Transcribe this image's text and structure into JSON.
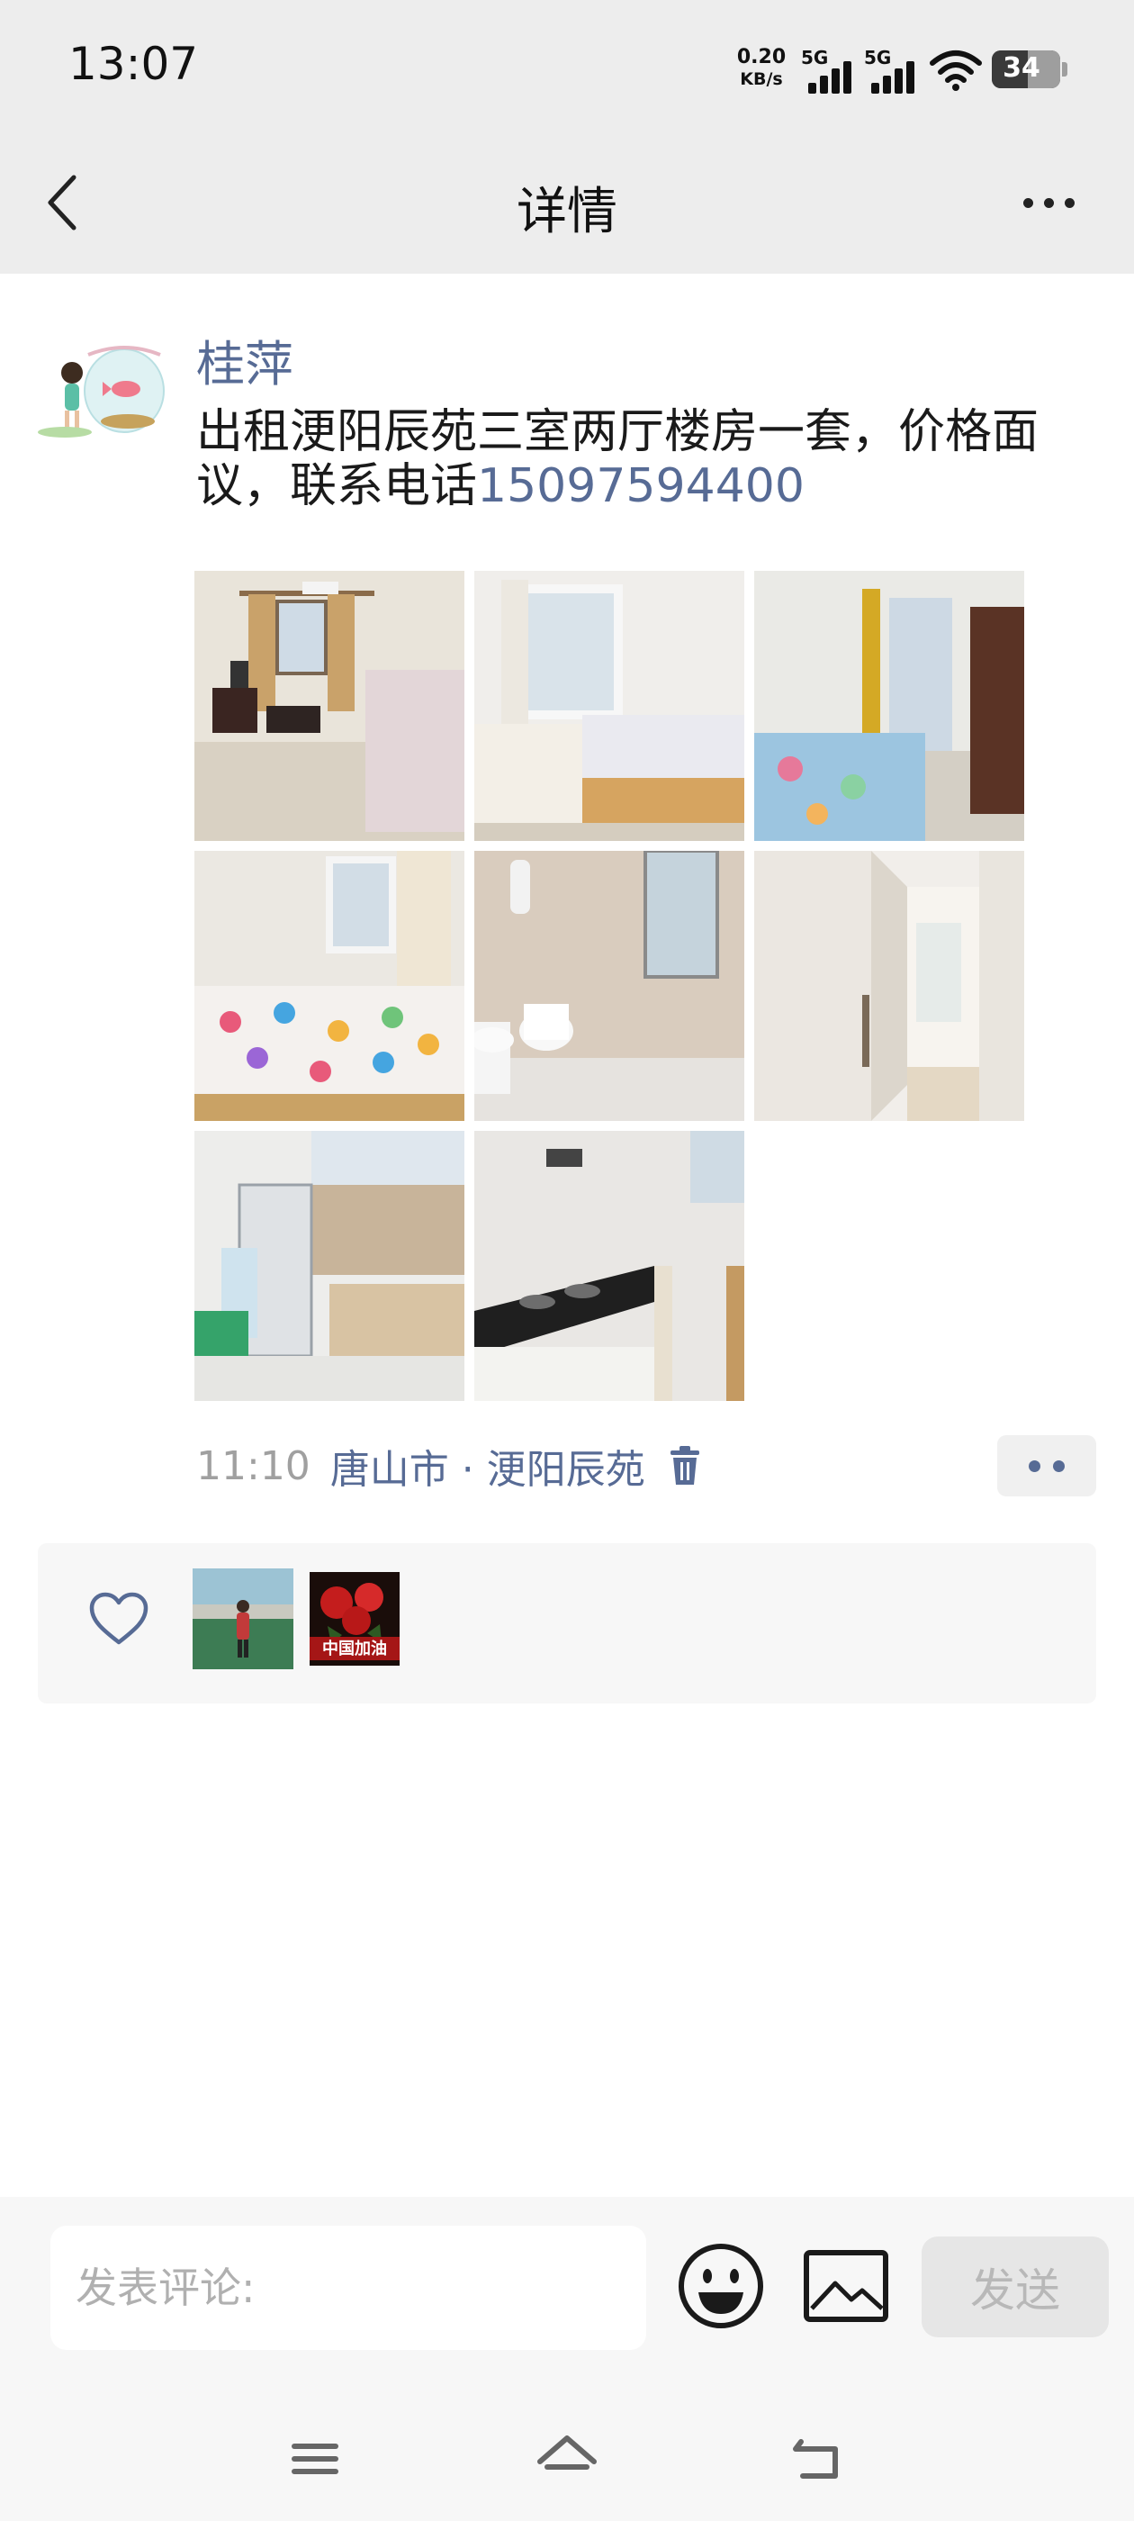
{
  "status_bar": {
    "time": "13:07",
    "net_speed_value": "0.20",
    "net_speed_unit": "KB/s",
    "signal_1_label": "5G",
    "signal_2_label": "5G",
    "battery": "34"
  },
  "header": {
    "title": "详情"
  },
  "post": {
    "username": "桂萍",
    "text": "出租浭阳辰苑三室两厅楼房一套，价格面议，联系电话",
    "phone": "15097594400",
    "time": "11:10",
    "location": "唐山市 · 浭阳辰苑",
    "photos": [
      {
        "icon": "living-room-photo"
      },
      {
        "icon": "bedroom-photo"
      },
      {
        "icon": "bedroom-balcony-photo"
      },
      {
        "icon": "bedroom-star-quilt-photo"
      },
      {
        "icon": "bathroom-photo"
      },
      {
        "icon": "hallway-photo"
      },
      {
        "icon": "fridge-room-photo"
      },
      {
        "icon": "kitchen-photo"
      }
    ]
  },
  "likes": {
    "users": [
      {
        "icon": "like-avatar-person"
      },
      {
        "icon": "like-avatar-roses",
        "badge": "中国加油"
      }
    ]
  },
  "comment_bar": {
    "placeholder": "发表评论:",
    "send_label": "发送"
  },
  "colors": {
    "link_blue": "#576b95",
    "header_bg": "#ededed",
    "meta_gray": "#a0a0a0"
  }
}
